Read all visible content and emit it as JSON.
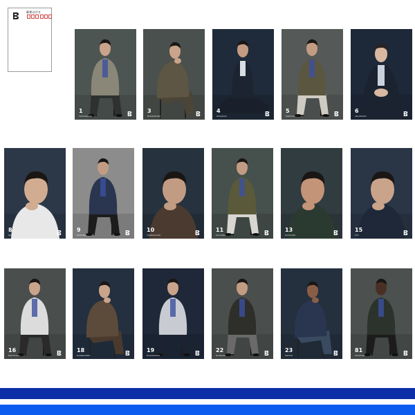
{
  "postcard": {
    "label": "郵便はがき",
    "logo_icon": "brand-logo-icon"
  },
  "cards": [
    {
      "number": "1",
      "name": "TAKAHASHI",
      "bg": "#4d5552",
      "coat": "#8a8778",
      "pants": "#2e3130",
      "skin": "#c9a48a"
    },
    {
      "number": "3",
      "name": "NISHIMURA",
      "bg": "#4a504d",
      "coat": "#5e5644",
      "pants": "#4a4536",
      "skin": "#c9a48a"
    },
    {
      "number": "4",
      "name": "OKAZAKI",
      "bg": "#1f2b3a",
      "coat": "#1c2432",
      "pants": "#1a202b",
      "skin": "#c29c82"
    },
    {
      "number": "5",
      "name": "MORITA",
      "bg": "#555a58",
      "coat": "#5a5640",
      "pants": "#cfcbc2",
      "skin": "#c29c82"
    },
    {
      "number": "6",
      "name": "JOHNSON",
      "bg": "#1d2838",
      "coat": "#1b2330",
      "pants": "#1b2330",
      "skin": "#d8b8a0"
    },
    {
      "number": "8",
      "name": "SAKAMOTO",
      "bg": "#2c3848",
      "coat": "#e8e8e8",
      "pants": "#e8e8e8",
      "skin": "#d2ac90"
    },
    {
      "number": "9",
      "name": "KIMURA",
      "bg": "#8c8c8c",
      "coat": "#2a3550",
      "pants": "#1c1c1c",
      "skin": "#c29c82"
    },
    {
      "number": "10",
      "name": "YAMAGUCHI",
      "bg": "#26323d",
      "coat": "#4a3a30",
      "pants": "#252525",
      "skin": "#c29c82"
    },
    {
      "number": "11",
      "name": "AOYAMA",
      "bg": "#46504c",
      "coat": "#5a5a3a",
      "pants": "#d8d6d0",
      "skin": "#c29c82"
    },
    {
      "number": "13",
      "name": "FUJISAKI",
      "bg": "#303c40",
      "coat": "#2a3a30",
      "pants": "#2a3a30",
      "skin": "#c49478"
    },
    {
      "number": "15",
      "name": "ITO",
      "bg": "#2a3546",
      "coat": "#1f2838",
      "pants": "#1f2838",
      "skin": "#c9a48a"
    },
    {
      "number": "16",
      "name": "MATSUDA",
      "bg": "#4a4f4d",
      "coat": "#dcdcdc",
      "pants": "#2a2a2a",
      "skin": "#c9a48a"
    },
    {
      "number": "18",
      "name": "HASEGAWA",
      "bg": "#243040",
      "coat": "#5c4a3a",
      "pants": "#4a3a2e",
      "skin": "#c9a48a"
    },
    {
      "number": "19",
      "name": "NAKAGAWA",
      "bg": "#1e2838",
      "coat": "#c8ccd2",
      "pants": "#1c2230",
      "skin": "#c9a48a"
    },
    {
      "number": "22",
      "name": "SHIMIZU",
      "bg": "#4a4f4d",
      "coat": "#2e2e2a",
      "pants": "#6a6a6a",
      "skin": "#c29c82"
    },
    {
      "number": "23",
      "name": "KENTA",
      "bg": "#24303e",
      "coat": "#2a3550",
      "pants": "#3a4a60",
      "skin": "#8a5e46"
    },
    {
      "number": "81",
      "name": "OKAFOR",
      "bg": "#4c514f",
      "coat": "#2c322c",
      "pants": "#1c1c1c",
      "skin": "#4a3024"
    }
  ],
  "stripes": {
    "top_color": "#0c2fa8",
    "bottom_color": "#0d5cf0"
  }
}
